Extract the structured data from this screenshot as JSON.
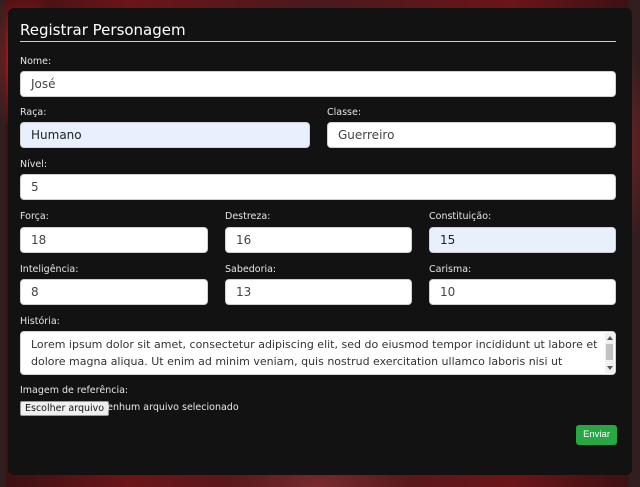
{
  "form": {
    "title": "Registrar Personagem",
    "name": {
      "label": "Nome:",
      "value": "José"
    },
    "race": {
      "label": "Raça:",
      "value": "Humano"
    },
    "class": {
      "label": "Classe:",
      "value": "Guerreiro"
    },
    "level": {
      "label": "Nível:",
      "value": "5"
    },
    "strength": {
      "label": "Força:",
      "value": "18"
    },
    "dexterity": {
      "label": "Destreza:",
      "value": "16"
    },
    "constitution": {
      "label": "Constituição:",
      "value": "15"
    },
    "intelligence": {
      "label": "Inteligência:",
      "value": "8"
    },
    "wisdom": {
      "label": "Sabedoria:",
      "value": "13"
    },
    "charisma": {
      "label": "Carisma:",
      "value": "10"
    },
    "history": {
      "label": "História:",
      "value": "Lorem ipsum dolor sit amet, consectetur adipiscing elit, sed do eiusmod tempor incididunt ut labore et dolore magna aliqua. Ut enim ad minim veniam, quis nostrud exercitation ullamco laboris nisi ut aliquip ex ea"
    },
    "image": {
      "label": "Imagem de referência:",
      "button": "Escolher arquivo",
      "status": "Nenhum arquivo selecionado"
    },
    "submit": "Enviar"
  },
  "colors": {
    "submit": "#28a745",
    "autofill": "#e8f0fe",
    "card": "#121212"
  }
}
